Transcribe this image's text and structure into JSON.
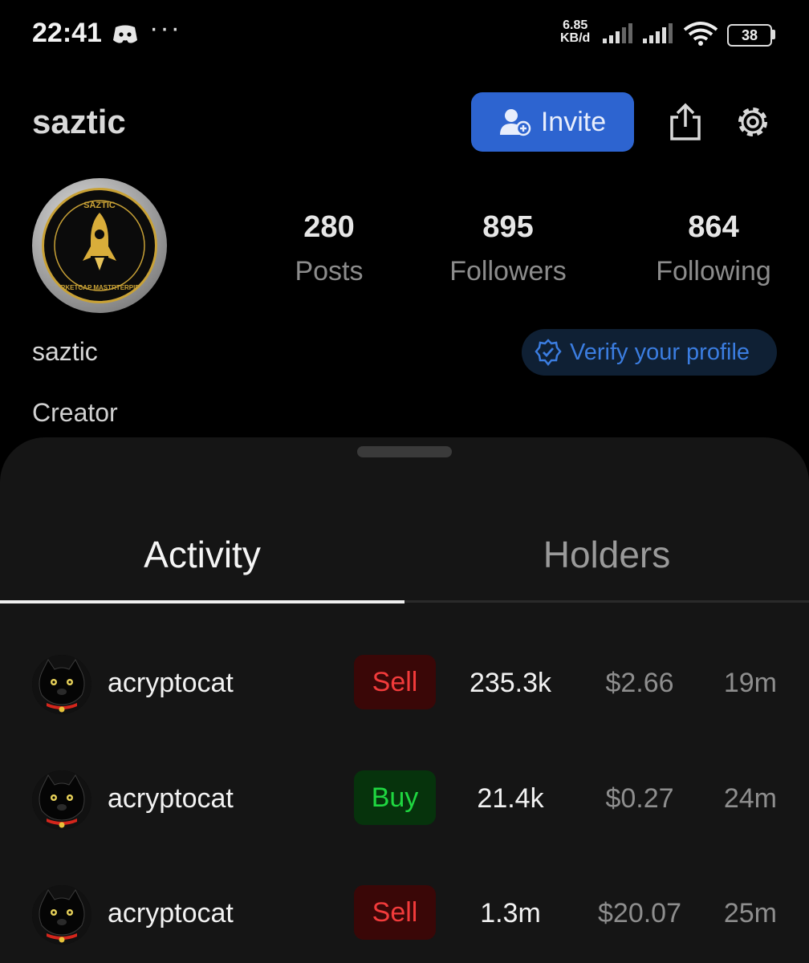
{
  "status_bar": {
    "time": "22:41",
    "dots": "···",
    "speed_value": "6.85",
    "speed_unit": "KB/d",
    "battery": "38",
    "icons": [
      "discord-icon",
      "signal-icon",
      "signal-icon",
      "wifi-icon",
      "battery-icon"
    ]
  },
  "header": {
    "title": "saztic",
    "invite_label": "Invite",
    "icons": [
      "add-user-icon",
      "share-icon",
      "gear-icon"
    ]
  },
  "profile": {
    "avatar_text_top": "SAZTIC",
    "avatar_text_bottom": "MARKETCAP MASTRTERPIECE",
    "stats": {
      "posts_count": "280",
      "posts_label": "Posts",
      "followers_count": "895",
      "followers_label": "Followers",
      "following_count": "864",
      "following_label": "Following"
    },
    "display_name": "saztic",
    "bio": "Creator",
    "verify_label": "Verify your profile"
  },
  "tabs": {
    "activity": "Activity",
    "holders": "Holders",
    "active": "Activity"
  },
  "activity": [
    {
      "user": "acryptocat",
      "type": "Sell",
      "amount": "235.3k",
      "price": "$2.66",
      "time": "19m"
    },
    {
      "user": "acryptocat",
      "type": "Buy",
      "amount": "21.4k",
      "price": "$0.27",
      "time": "24m"
    },
    {
      "user": "acryptocat",
      "type": "Sell",
      "amount": "1.3m",
      "price": "$20.07",
      "time": "25m"
    }
  ],
  "colors": {
    "accent_blue": "#2d64d0",
    "sell_red": "#f23b3b",
    "buy_green": "#1fd640",
    "gold": "#c9a236"
  }
}
